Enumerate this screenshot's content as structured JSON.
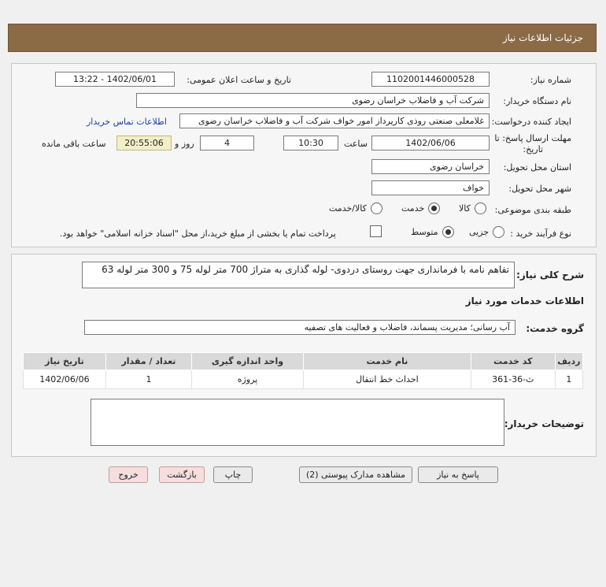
{
  "header": {
    "title": "جزئیات اطلاعات نیاز"
  },
  "form": {
    "need_number_label": "شماره نیاز:",
    "need_number": "1102001446000528",
    "announce_label": "تاریخ و ساعت اعلان عمومی:",
    "announce_value": "1402/06/01 - 13:22",
    "buyer_org_label": "نام دستگاه خریدار:",
    "buyer_org": "شرکت آب و فاضلاب خراسان رضوی",
    "requester_label": "ایجاد کننده درخواست:",
    "requester": "غلامعلی صنعتی روذی کارپرداز امور خواف  شرکت آب و فاضلاب خراسان رضوی",
    "contact_link": "اطلاعات تماس خریدار",
    "deadline_label_1": "مهلت ارسال پاسخ: تا",
    "deadline_label_2": "تاریخ:",
    "deadline_date": "1402/06/06",
    "time_label": "ساعت",
    "deadline_time": "10:30",
    "days_value": "4",
    "days_label": "روز و",
    "remaining_time": "20:55:06",
    "remaining_label": "ساعت باقی مانده",
    "province_label": "استان محل تحویل:",
    "province": "خراسان رضوی",
    "city_label": "شهر محل تحویل:",
    "city": "خواف",
    "category_label": "طبقه بندی موضوعی:",
    "category_options": [
      "کالا",
      "خدمت",
      "کالا/خدمت"
    ],
    "category_selected": "خدمت",
    "process_label": "نوع فرآیند خرید :",
    "process_options": [
      "جزیی",
      "متوسط"
    ],
    "process_selected": "متوسط",
    "payment_note": "پرداخت تمام یا بخشی از مبلغ خرید،از محل \"اسناد خزانه اسلامی\" خواهد بود."
  },
  "details": {
    "summary_label": "شرح کلی نیاز:",
    "summary": "تفاهم نامه با فرمانداری جهت روستای دردوی- لوله گذاری به متراژ 700 متر لوله 75 و 300 متر لوله 63",
    "services_heading": "اطلاعات خدمات مورد نیاز",
    "service_group_label": "گروه خدمت:",
    "service_group": "آب رسانی؛ مدیریت پسماند، فاضلاب و فعالیت های تصفیه",
    "table": {
      "headers": [
        "ردیف",
        "کد خدمت",
        "نام خدمت",
        "واحد اندازه گیری",
        "تعداد / مقدار",
        "تاریخ نیاز"
      ],
      "rows": [
        [
          "1",
          "ث-36-361",
          "احداث خط انتقال",
          "پروژه",
          "1",
          "1402/06/06"
        ]
      ]
    },
    "buyer_notes_label": "توضیحات خریدار:",
    "buyer_notes": ""
  },
  "buttons": {
    "reply": "پاسخ به نیاز",
    "view_docs": "مشاهده مدارک پیوستی (2)",
    "print": "چاپ",
    "back": "بازگشت",
    "exit": "خروج"
  }
}
